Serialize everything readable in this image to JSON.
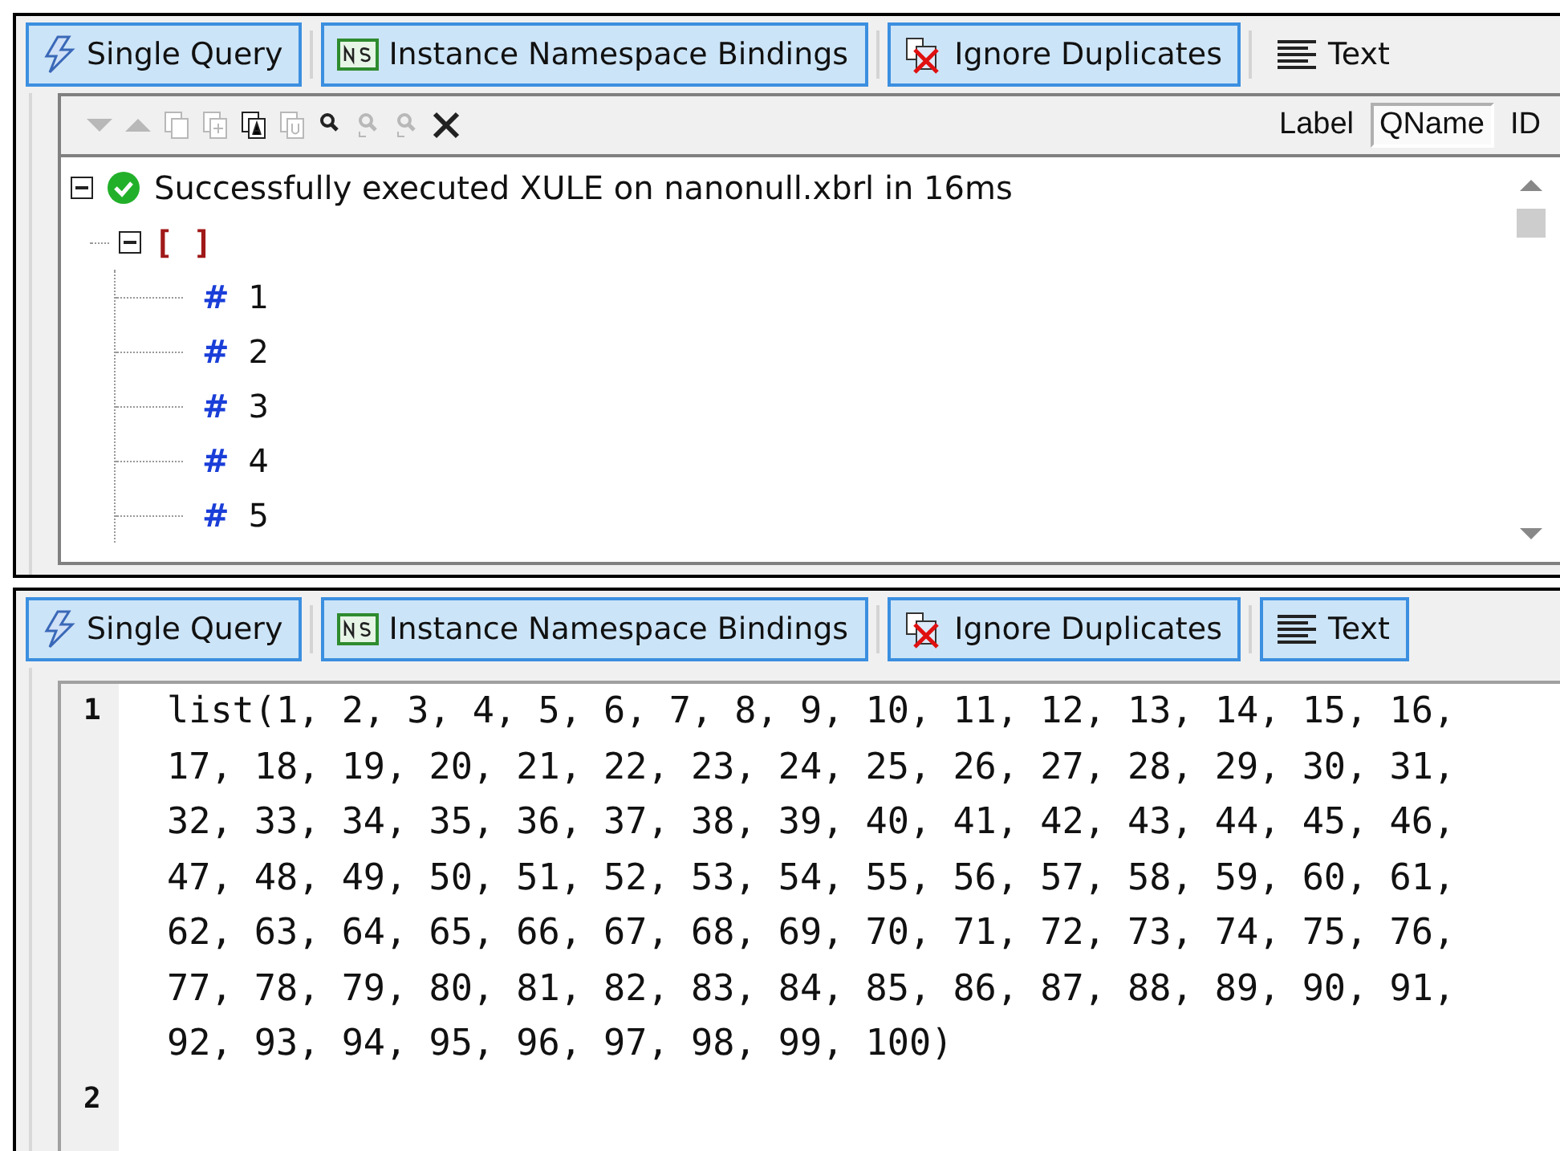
{
  "panels": [
    {
      "toolbar": [
        {
          "kind": "query",
          "label": "Single Query",
          "selected": true
        },
        {
          "kind": "namespace",
          "label": "Instance Namespace Bindings",
          "selected": true
        },
        {
          "kind": "duplicates",
          "label": "Ignore Duplicates",
          "selected": true
        },
        {
          "kind": "text",
          "label": "Text",
          "selected": false
        }
      ],
      "view": {
        "kind": "tree",
        "tools": [
          {
            "kind": "down",
            "disabled": true
          },
          {
            "kind": "up",
            "disabled": true
          },
          {
            "kind": "copy",
            "disabled": true
          },
          {
            "kind": "copy-plus",
            "disabled": true
          },
          {
            "kind": "copy-a",
            "disabled": false
          },
          {
            "kind": "copy-u",
            "disabled": true
          },
          {
            "kind": "find",
            "disabled": false
          },
          {
            "kind": "find-prev",
            "disabled": true
          },
          {
            "kind": "find-next",
            "disabled": true
          },
          {
            "kind": "close",
            "disabled": false
          }
        ],
        "name_modes": [
          {
            "label": "Label",
            "selected": false
          },
          {
            "label": "QName",
            "selected": true
          },
          {
            "label": "ID",
            "selected": false
          }
        ],
        "root": {
          "text": "Successfully executed XULE on nanonull.xbrl in 16ms",
          "expanded": true,
          "children": [
            {
              "text": "[ ]",
              "expanded": true,
              "children": [
                {
                  "symbol": "#",
                  "value": "1"
                },
                {
                  "symbol": "#",
                  "value": "2"
                },
                {
                  "symbol": "#",
                  "value": "3"
                },
                {
                  "symbol": "#",
                  "value": "4"
                },
                {
                  "symbol": "#",
                  "value": "5"
                }
              ]
            }
          ]
        }
      }
    },
    {
      "toolbar": [
        {
          "kind": "query",
          "label": "Single Query",
          "selected": true
        },
        {
          "kind": "namespace",
          "label": "Instance Namespace Bindings",
          "selected": true
        },
        {
          "kind": "duplicates",
          "label": "Ignore Duplicates",
          "selected": true
        },
        {
          "kind": "text",
          "label": "Text",
          "selected": true
        }
      ],
      "view": {
        "kind": "code",
        "lines": [
          {
            "number": "1",
            "text": "list(1, 2, 3, 4, 5, 6, 7, 8, 9, 10, 11, 12, 13, 14, 15, 16, 17, 18, 19, 20, 21, 22, 23, 24, 25, 26, 27, 28, 29, 30, 31, 32, 33, 34, 35, 36, 37, 38, 39, 40, 41, 42, 43, 44, 45, 46, 47, 48, 49, 50, 51, 52, 53, 54, 55, 56, 57, 58, 59, 60, 61, 62, 63, 64, 65, 66, 67, 68, 69, 70, 71, 72, 73, 74, 75, 76, 77, 78, 79, 80, 81, 82, 83, 84, 85, 86, 87, 88, 89, 90, 91, 92, 93, 94, 95, 96, 97, 98, 99, 100)"
          },
          {
            "number": "2"
          }
        ]
      }
    }
  ]
}
